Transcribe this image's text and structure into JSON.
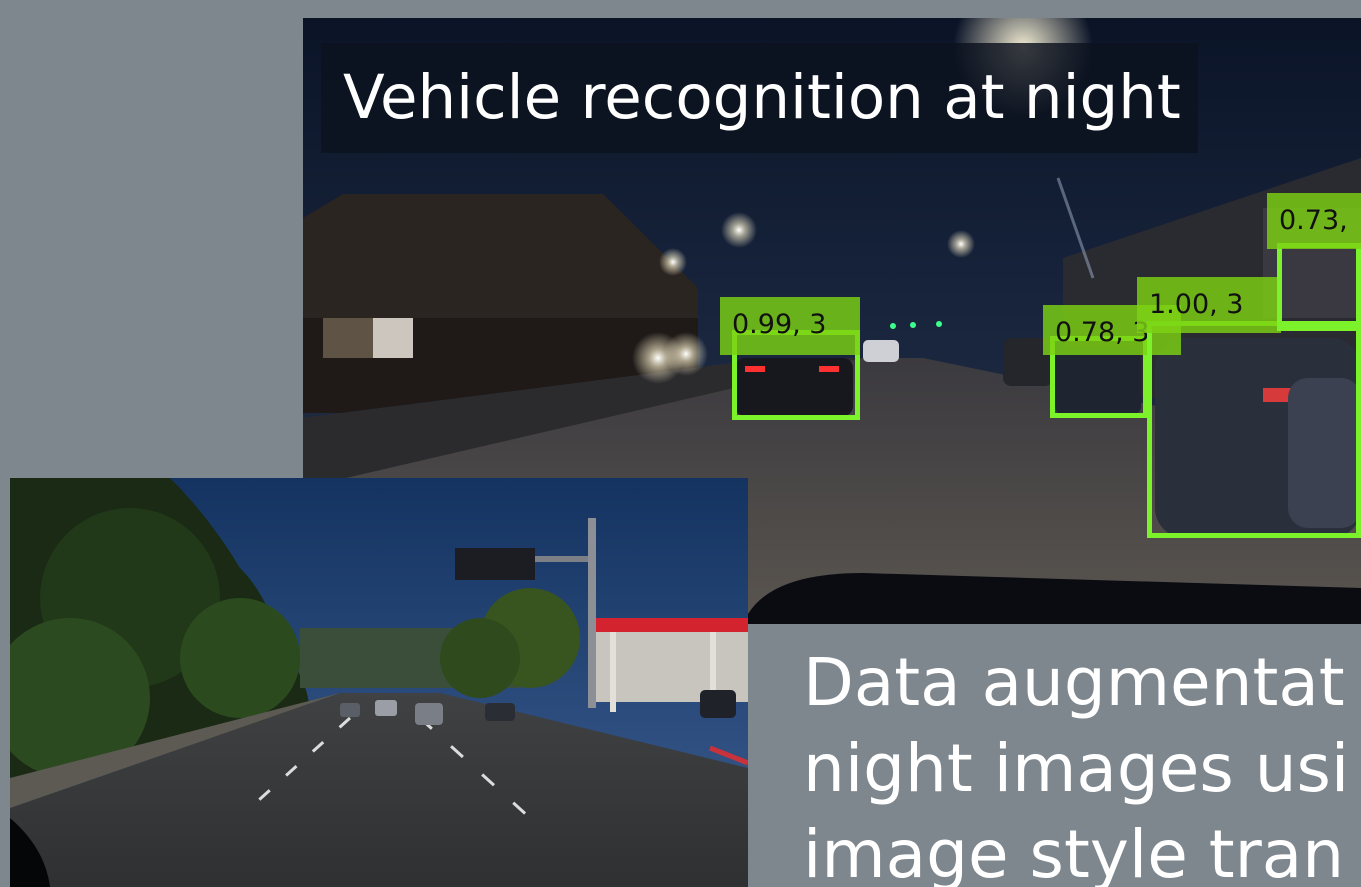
{
  "slide": {
    "night_title": "Vehicle recognition at night",
    "detections": [
      {
        "label": "0.99, 3"
      },
      {
        "label": "0.78, 3"
      },
      {
        "label": "1.00, 3"
      },
      {
        "label": "0.73,"
      }
    ],
    "caption_lines": [
      "Data augmentat",
      "night images usi",
      "image style tran"
    ],
    "colors": {
      "background": "#7e878e",
      "box": "#7cf22a",
      "label_bg": "#7cd214",
      "title_bg": "#0c121e",
      "text": "#ffffff"
    }
  }
}
